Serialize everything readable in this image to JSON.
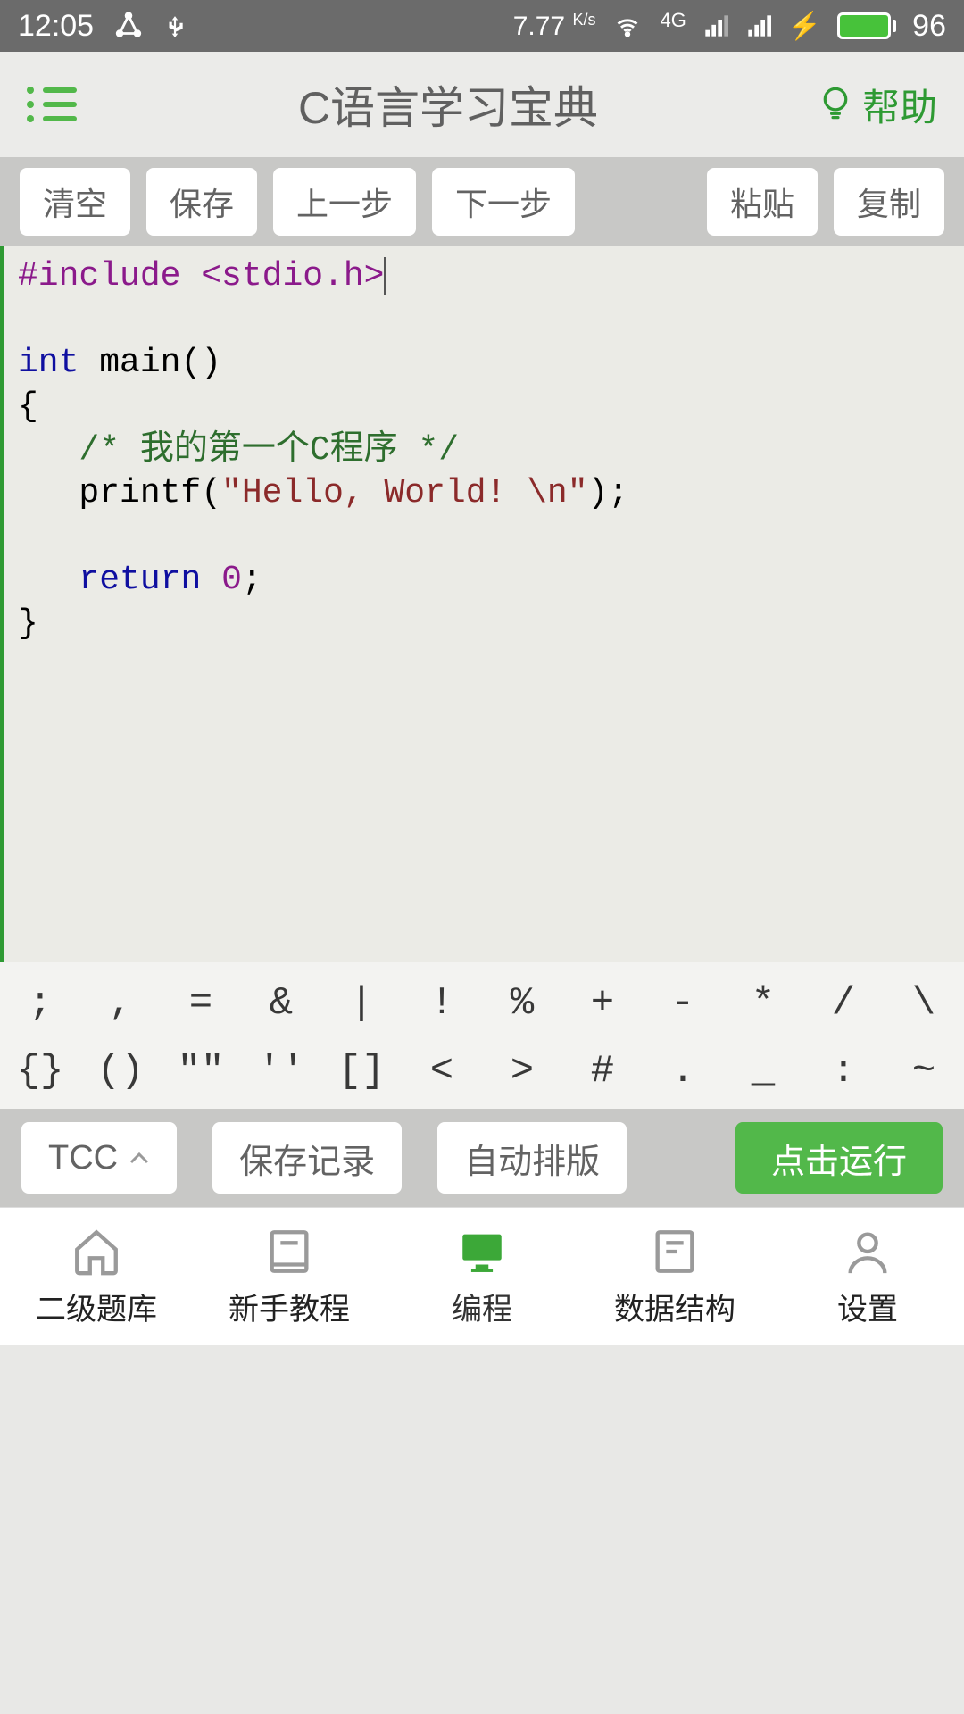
{
  "status": {
    "time": "12:05",
    "speed": "7.77",
    "speed_unit": "K/s",
    "network": "4G",
    "battery": "96"
  },
  "header": {
    "title": "C语言学习宝典",
    "help": "帮助"
  },
  "toolbar": {
    "clear": "清空",
    "save": "保存",
    "prev": "上一步",
    "next": "下一步",
    "paste": "粘贴",
    "copy": "复制"
  },
  "code": {
    "line1_pp": "#include",
    "line1_hdr": "<stdio.h>",
    "line3_kw": "int",
    "line3_rest": " main()",
    "line4": "{",
    "line5_cm": "/* 我的第一个C程序 */",
    "line6_a": "   printf(",
    "line6_str": "\"Hello, World! \\n\"",
    "line6_b": ");",
    "line8_kw": "return",
    "line8_num": "0",
    "line8_semi": ";",
    "line9": "}"
  },
  "symbols": {
    "r1": [
      ";",
      ",",
      "=",
      "&",
      "|",
      "!",
      "%",
      "+",
      "-",
      "*",
      "/",
      "\\"
    ],
    "r2": [
      "{}",
      "()",
      "\"\"",
      "''",
      "[]",
      "<",
      ">",
      "#",
      ".",
      "_",
      ":",
      "~"
    ]
  },
  "actions": {
    "compiler": "TCC",
    "save_log": "保存记录",
    "auto_format": "自动排版",
    "run": "点击运行"
  },
  "nav": {
    "items": [
      {
        "label": "二级题库"
      },
      {
        "label": "新手教程"
      },
      {
        "label": "编程"
      },
      {
        "label": "数据结构"
      },
      {
        "label": "设置"
      }
    ]
  }
}
